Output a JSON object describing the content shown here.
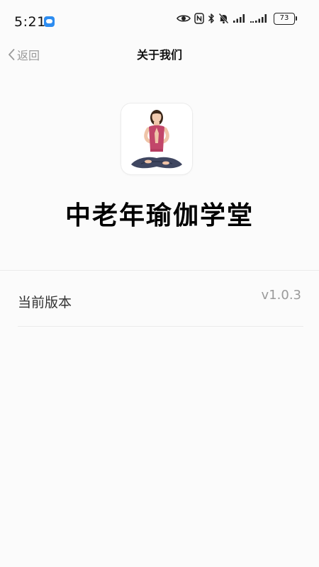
{
  "status_bar": {
    "time": "5:21",
    "battery": "73"
  },
  "nav": {
    "back_label": "返回",
    "title": "关于我们"
  },
  "app": {
    "name": "中老年瑜伽学堂"
  },
  "version_row": {
    "label": "当前版本",
    "value": "v1.0.3"
  }
}
